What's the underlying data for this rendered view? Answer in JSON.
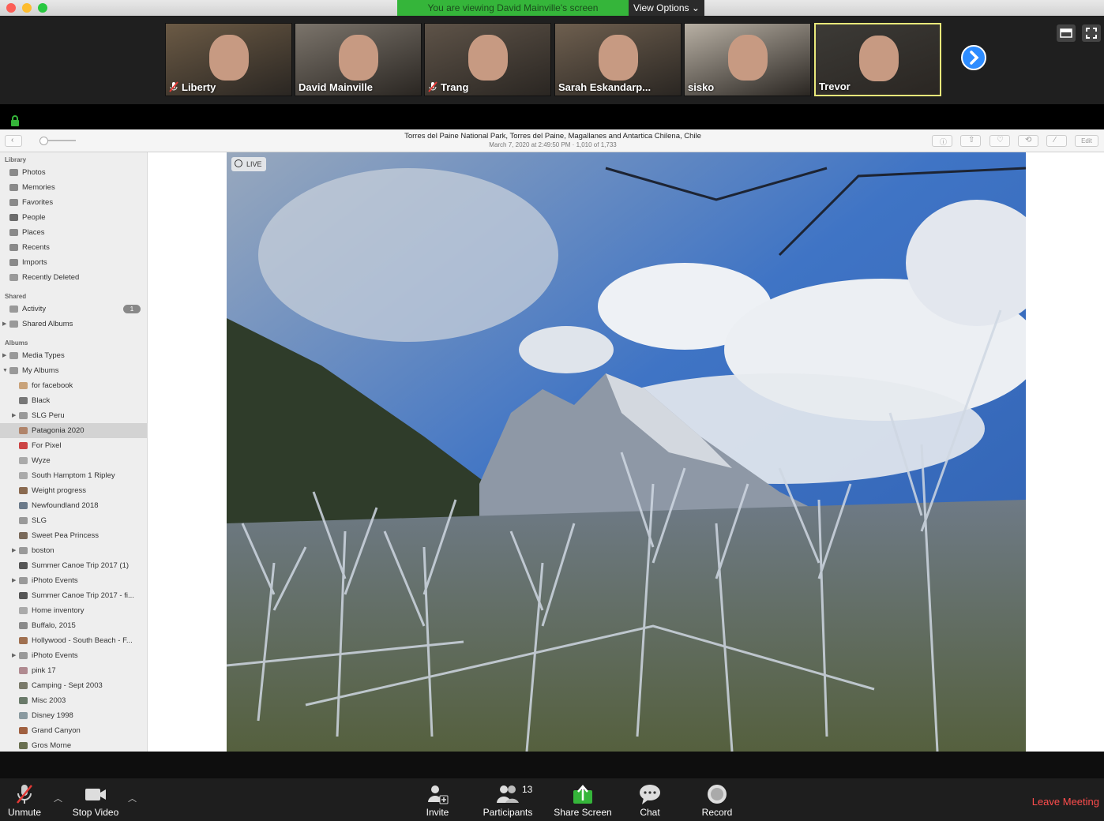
{
  "banner": {
    "viewing_text": "You are viewing David Mainville's screen",
    "view_options": "View Options"
  },
  "gallery": {
    "participants": [
      {
        "name": "Liberty",
        "muted": true,
        "bg": "#6b5a45"
      },
      {
        "name": "David Mainville",
        "muted": false,
        "bg": "#7b746b"
      },
      {
        "name": "Trang",
        "muted": true,
        "bg": "#5e5348"
      },
      {
        "name": "Sarah Eskandarp...",
        "muted": false,
        "bg": "#6e5f4f"
      },
      {
        "name": "sisko",
        "muted": false,
        "bg": "#b8b0a4"
      },
      {
        "name": "Trevor",
        "muted": false,
        "bg": "#3c3a36",
        "active": true
      }
    ]
  },
  "photos": {
    "title": "Torres del Paine National Park, Torres del Paine, Magallanes and Antartica Chilena, Chile",
    "subtitle": "March 7, 2020 at 2:49:50 PM   ·   1,010 of 1,733",
    "edit_label": "Edit",
    "live_label": "LIVE",
    "sidebar": {
      "library_header": "Library",
      "library": [
        "Photos",
        "Memories",
        "Favorites",
        "People",
        "Places",
        "Recents",
        "Imports",
        "Recently Deleted"
      ],
      "shared_header": "Shared",
      "shared": [
        "Activity",
        "Shared Albums"
      ],
      "activity_badge": "1",
      "albums_header": "Albums",
      "albums_top": [
        "Media Types",
        "My Albums"
      ],
      "my_albums": [
        "for facebook",
        "Black",
        "SLG Peru",
        "Patagonia 2020",
        "For Pixel",
        "Wyze",
        "South Hamptom 1 Ripley",
        "Weight progress",
        "Newfoundland 2018",
        "SLG",
        "Sweet Pea Princess",
        "boston",
        "Summer Canoe Trip 2017 (1)",
        "iPhoto Events",
        "Summer Canoe Trip 2017 - fi...",
        "Home inventory",
        "Buffalo, 2015",
        "Hollywood - South Beach - F...",
        "iPhoto Events",
        "pink 17",
        "Camping - Sept 2003",
        "Misc 2003",
        "Disney 1998",
        "Grand Canyon",
        "Gros Morne"
      ],
      "selected_album": "Patagonia 2020"
    }
  },
  "controls": {
    "unmute": "Unmute",
    "stop_video": "Stop Video",
    "invite": "Invite",
    "participants": "Participants",
    "participant_count": "13",
    "share_screen": "Share Screen",
    "chat": "Chat",
    "record": "Record",
    "leave": "Leave Meeting"
  },
  "colors": {
    "share_green": "#35b53a",
    "zoom_blue": "#2d8cff",
    "leave_red": "#ff4d4d"
  }
}
